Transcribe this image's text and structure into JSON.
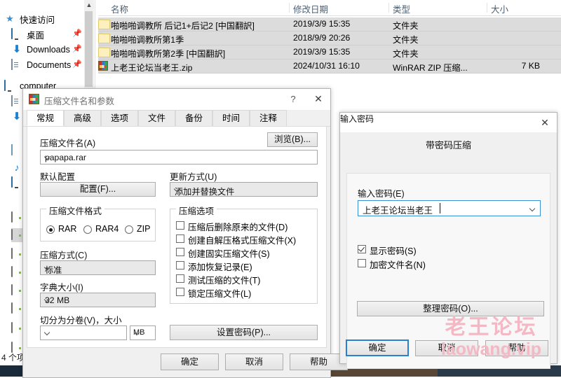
{
  "explorer": {
    "nav_items": [
      {
        "label": "快速访问",
        "icon": "star-icon",
        "pinned": false
      },
      {
        "label": "桌面",
        "icon": "monitor-icon",
        "pinned": true
      },
      {
        "label": "Downloads",
        "icon": "download-arrow-icon",
        "pinned": true
      },
      {
        "label": "Documents",
        "icon": "document-icon",
        "pinned": true
      },
      {
        "label": "computer",
        "icon": "computer-icon",
        "pinned": false
      }
    ],
    "columns": [
      "名称",
      "修改日期",
      "类型",
      "大小"
    ],
    "rows": [
      {
        "name": "啪啪啪调教所 后记1+后记2 [中国翻訳]",
        "date": "2019/3/9 15:35",
        "type": "文件夹",
        "size": "",
        "icon": "folder-icon"
      },
      {
        "name": "啪啪啪调教所第1季",
        "date": "2018/9/9 20:26",
        "type": "文件夹",
        "size": "",
        "icon": "folder-icon"
      },
      {
        "name": "啪啪啪调教所第2季 [中国翻訳]",
        "date": "2019/3/9 15:35",
        "type": "文件夹",
        "size": "",
        "icon": "folder-icon"
      },
      {
        "name": "上老王论坛当老王.zip",
        "date": "2024/10/31 16:10",
        "type": "WinRAR ZIP 压缩...",
        "size": "7 KB",
        "icon": "winrar-icon"
      }
    ],
    "status": "4 个项"
  },
  "archive_dialog": {
    "title": "压缩文件名和参数",
    "help_glyph": "?",
    "close_glyph": "✕",
    "tabs": [
      {
        "label": "常规",
        "active": true
      },
      {
        "label": "高级",
        "active": false
      },
      {
        "label": "选项",
        "active": false
      },
      {
        "label": "文件",
        "active": false
      },
      {
        "label": "备份",
        "active": false
      },
      {
        "label": "时间",
        "active": false
      },
      {
        "label": "注释",
        "active": false
      }
    ],
    "archive_name_label": "压缩文件名(A)",
    "archive_name_value": "papapa.rar",
    "browse_button": "浏览(B)...",
    "profile_label": "默认配置",
    "profile_button": "配置(F)...",
    "update_mode_label": "更新方式(U)",
    "update_mode_value": "添加并替换文件",
    "format_group": "压缩文件格式",
    "format_options": [
      {
        "label": "RAR",
        "selected": true
      },
      {
        "label": "RAR4",
        "selected": false
      },
      {
        "label": "ZIP",
        "selected": false
      }
    ],
    "method_label": "压缩方式(C)",
    "method_value": "标准",
    "dict_label": "字典大小(I)",
    "dict_value": "32 MB",
    "split_label": "切分为分卷(V)，大小",
    "split_value": "",
    "split_unit": "MB",
    "options_group": "压缩选项",
    "options": [
      {
        "label": "压缩后删除原来的文件(D)",
        "checked": false
      },
      {
        "label": "创建自解压格式压缩文件(X)",
        "checked": false
      },
      {
        "label": "创建固实压缩文件(S)",
        "checked": false
      },
      {
        "label": "添加恢复记录(E)",
        "checked": false
      },
      {
        "label": "测试压缩的文件(T)",
        "checked": false
      },
      {
        "label": "锁定压缩文件(L)",
        "checked": false
      }
    ],
    "set_password_button": "设置密码(P)...",
    "ok_button": "确定",
    "cancel_button": "取消",
    "help_button": "帮助"
  },
  "password_dialog": {
    "title": "输入密码",
    "close_glyph": "✕",
    "heading": "带密码压缩",
    "password_label": "输入密码(E)",
    "password_value": "上老王论坛当老王",
    "show_password": {
      "label": "显示密码(S)",
      "checked": true
    },
    "encrypt_names": {
      "label": "加密文件名(N)",
      "checked": false
    },
    "organize_button": "整理密码(O)...",
    "ok_button": "确定",
    "cancel_button": "取消",
    "help_button": "帮助"
  },
  "watermark": {
    "line1": "老王论坛",
    "line2": "laowang.vip",
    "color": "#f4b8c4"
  }
}
